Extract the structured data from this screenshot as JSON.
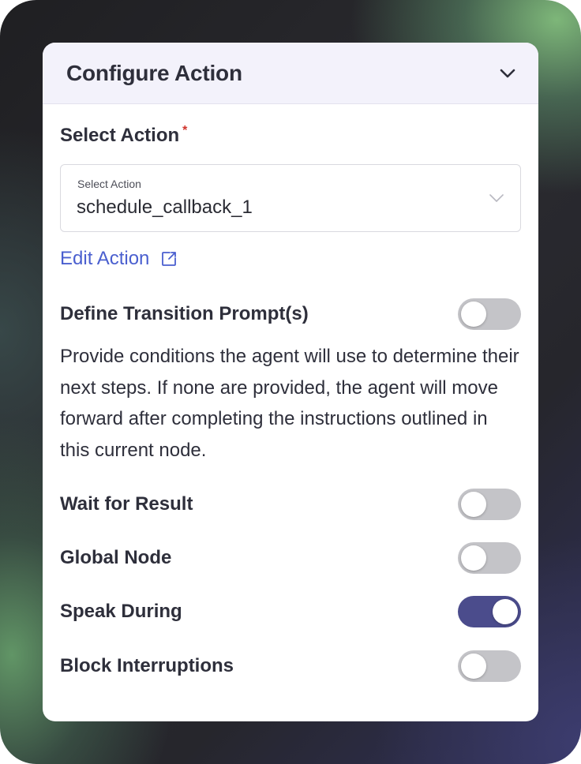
{
  "panel": {
    "title": "Configure Action"
  },
  "select_action": {
    "section_label": "Select Action",
    "required_marker": "*",
    "field_label": "Select Action",
    "value": "schedule_callback_1"
  },
  "edit_link": {
    "label": "Edit Action"
  },
  "transition": {
    "label": "Define Transition Prompt(s)",
    "enabled": false,
    "description": "Provide conditions the agent will use to determine their next steps. If none are provided, the agent will move forward after completing the instructions outlined in this current node."
  },
  "toggles": [
    {
      "label": "Wait for Result",
      "enabled": false
    },
    {
      "label": "Global Node",
      "enabled": false
    },
    {
      "label": "Speak During",
      "enabled": true
    },
    {
      "label": "Block Interruptions",
      "enabled": false
    }
  ],
  "colors": {
    "accent": "#4b4c8c",
    "link": "#4a5fcf",
    "required": "#d0342c",
    "toggle_off": "#c4c4c8",
    "header_bg": "#f3f2fb"
  },
  "icons": {
    "collapse": "chevron-down-icon",
    "select": "chevron-down-icon",
    "edit_link": "external-link-icon"
  }
}
